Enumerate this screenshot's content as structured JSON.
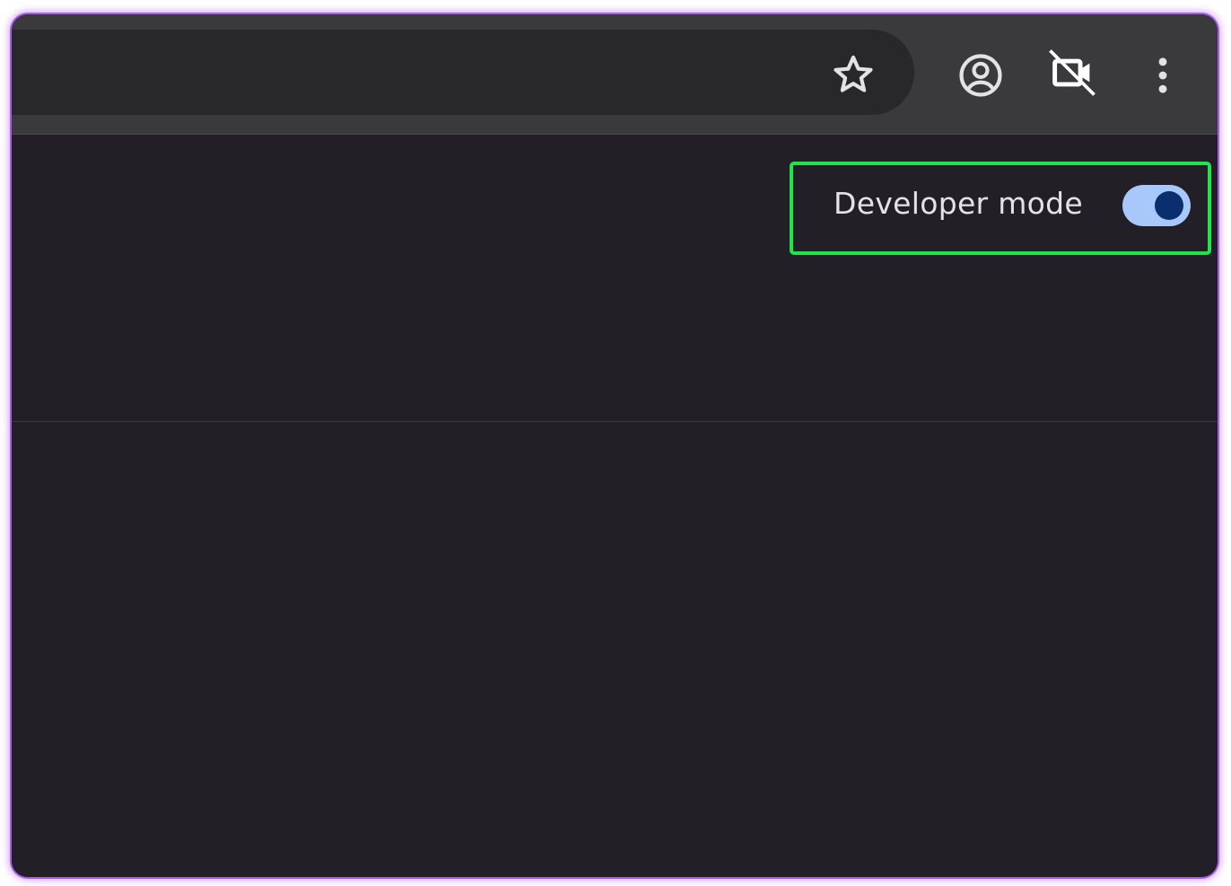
{
  "toolbar": {
    "icons": {
      "bookmark": "star-icon",
      "profile": "account-circle-icon",
      "camera": "camera-off-icon",
      "menu": "more-vert-icon"
    }
  },
  "extensions_header": {
    "developer_mode_label": "Developer mode",
    "developer_mode_enabled": true
  },
  "colors": {
    "toolbar_bg": "#3a393c",
    "omnibox_bg": "#28282a",
    "page_bg": "#231f26",
    "toggle_track_on": "#a8c7fa",
    "toggle_knob_on": "#0b2e6e",
    "highlight": "#1fe54a",
    "frame_glow": "#a95af0"
  }
}
